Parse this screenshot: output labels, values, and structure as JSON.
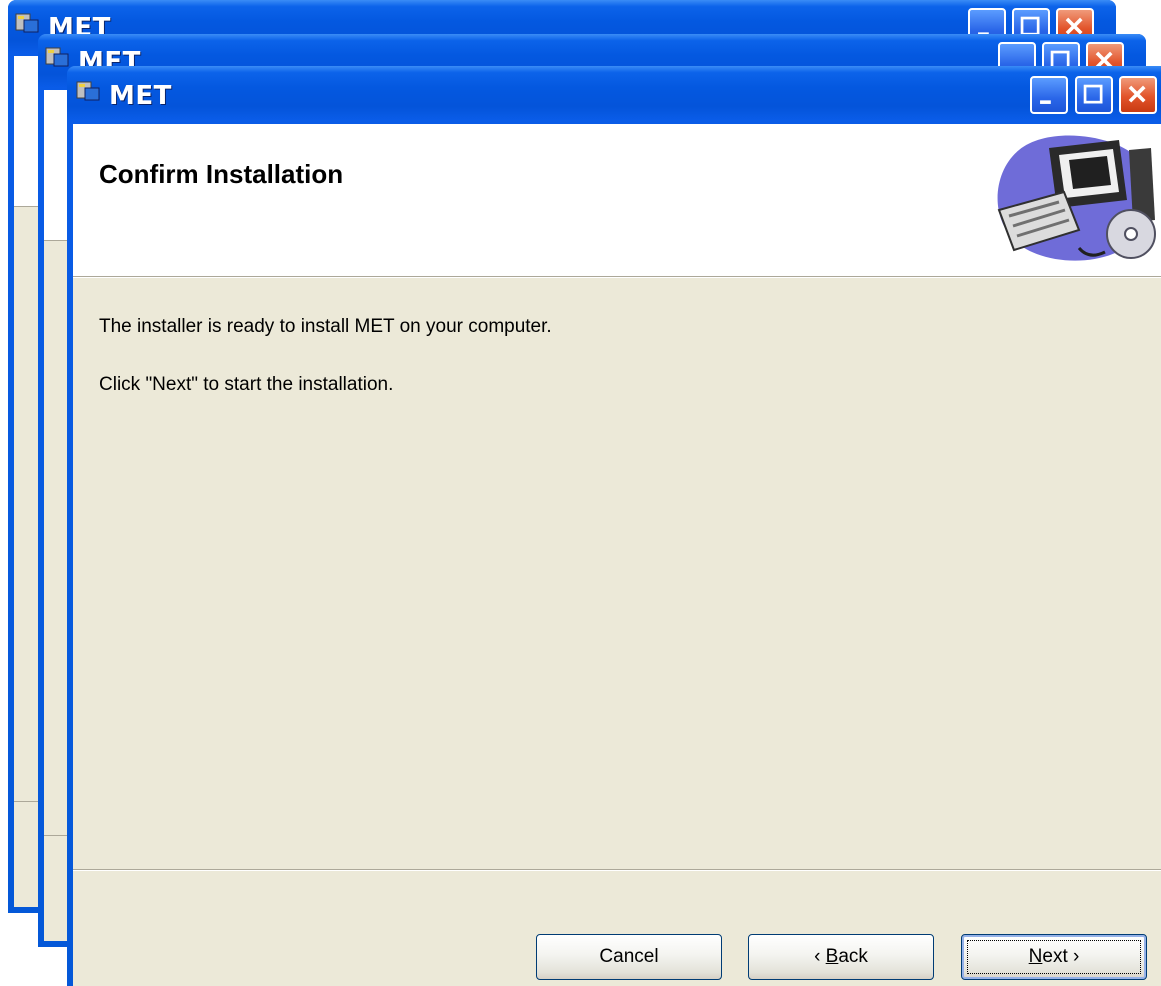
{
  "windows": [
    {
      "title": "MET",
      "state": "background"
    },
    {
      "title": "MET",
      "state": "background"
    },
    {
      "title": "MET",
      "state": "active"
    }
  ],
  "dialog": {
    "title": "MET",
    "page_title": "Confirm Installation",
    "banner_icon": "computer-install-icon",
    "body": {
      "line1": "The installer is ready to install MET on your computer.",
      "line2": "Click \"Next\" to start the installation."
    },
    "buttons": {
      "cancel": "Cancel",
      "back_prefix": "‹ ",
      "back_accel": "B",
      "back_rest": "ack",
      "next_accel": "N",
      "next_rest": "ext ›"
    }
  },
  "title_buttons": [
    "minimize-icon",
    "maximize-icon",
    "close-icon"
  ],
  "colors": {
    "titlebar": "#0458e0",
    "dialog_bg": "#ece9d8",
    "close_button": "#e2542b"
  }
}
